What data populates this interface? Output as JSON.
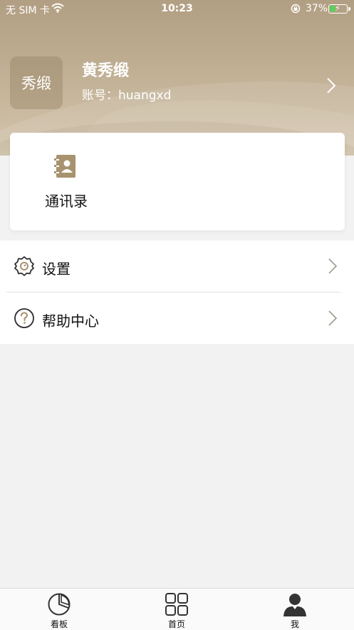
{
  "status_bar": {
    "carrier": "无 SIM 卡",
    "time": "10:23",
    "battery_percent": "37%",
    "battery_level": 0.37,
    "wifi_icon": "wifi-icon",
    "lock_icon": "orientation-lock-icon"
  },
  "profile": {
    "avatar_text": "秀缎",
    "name": "黄秀缎",
    "account": "账号：huangxd",
    "chevron_icon": "chevron-right-icon"
  },
  "card": {
    "contacts_label": "通讯录",
    "contacts_icon": "contacts-book-icon"
  },
  "menu": {
    "items": [
      {
        "label": "设置",
        "icon": "settings-gear-icon"
      },
      {
        "label": "帮助中心",
        "icon": "help-question-icon"
      }
    ]
  },
  "tabbar": {
    "tabs": [
      {
        "label": "看板",
        "icon": "pie-chart-icon"
      },
      {
        "label": "首页",
        "icon": "grid-icon"
      },
      {
        "label": "我",
        "icon": "person-icon",
        "active": true
      }
    ]
  },
  "colors": {
    "header_gold": "#bcab8f",
    "icon_gold": "#a8936f",
    "page_bg": "#f2f2f2"
  }
}
